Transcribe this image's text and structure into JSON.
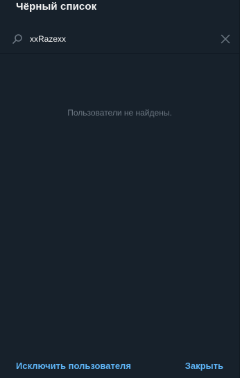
{
  "dialog": {
    "title": "Чёрный список"
  },
  "search": {
    "value": "xxRazexx",
    "search_icon": "search-icon",
    "clear_icon": "close-icon"
  },
  "content": {
    "empty_message": "Пользователи не найдены."
  },
  "footer": {
    "unblock_label": "Исключить пользователя",
    "close_label": "Закрыть"
  },
  "colors": {
    "background": "#17212b",
    "text_primary": "#f5f5f5",
    "text_muted": "#6d7883",
    "accent": "#5eb5f7"
  }
}
